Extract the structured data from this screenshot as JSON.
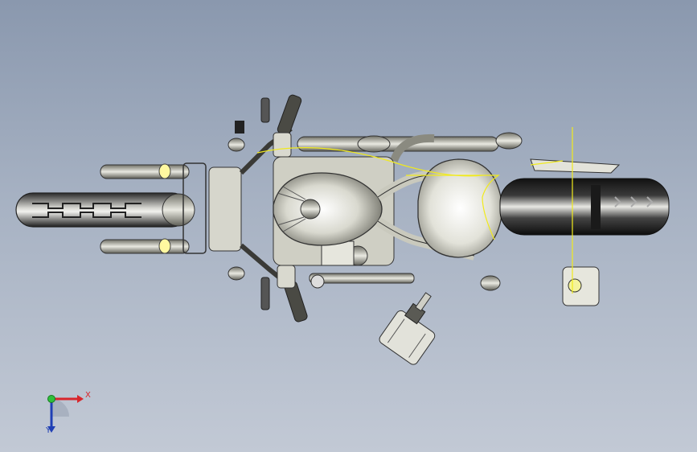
{
  "viewport": {
    "background_top": "#8a98ae",
    "background_bottom": "#c2c9d5"
  },
  "model": {
    "name": "motorcycle-top-view"
  },
  "triad": {
    "x_label": "X",
    "y_label": "Y",
    "x_color": "#d8262b",
    "y_color": "#1f3fb5",
    "origin_color": "#2fbf3a"
  }
}
